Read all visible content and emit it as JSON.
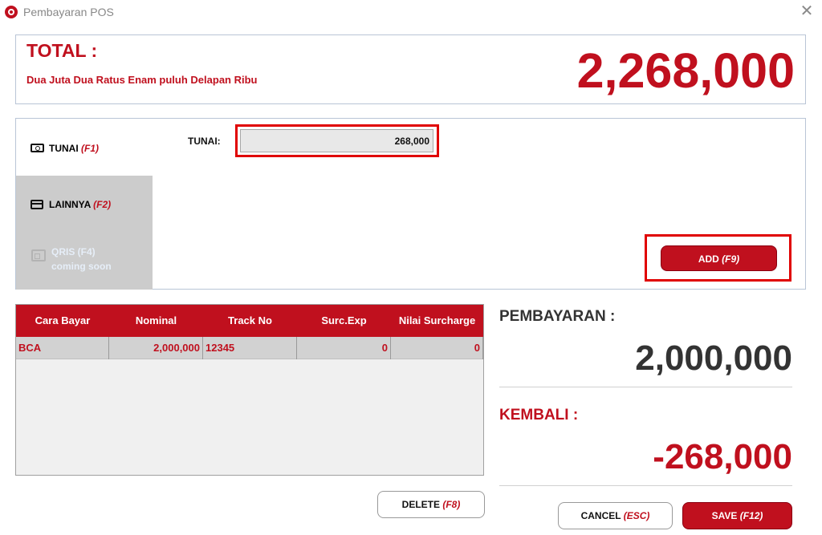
{
  "window": {
    "title": "Pembayaran POS",
    "close_glyph": "✕",
    "icon": "app-logo-icon"
  },
  "total": {
    "label": "TOTAL :",
    "words": "Dua Juta Dua Ratus Enam puluh Delapan Ribu",
    "amount": "2,268,000"
  },
  "tabs": [
    {
      "label": "TUNAI",
      "key": "(F1)",
      "icon": "cash-icon",
      "state": "active"
    },
    {
      "label": "LAINNYA",
      "key": "(F2)",
      "icon": "card-icon",
      "state": "inactive"
    },
    {
      "line1": "QRIS (F4)",
      "line2": "coming soon",
      "icon": "wallet-icon",
      "state": "disabled"
    }
  ],
  "tunai": {
    "label": "TUNAI:",
    "value": "268,000"
  },
  "add_button": {
    "label": "ADD",
    "key": "(F9)"
  },
  "grid": {
    "columns": [
      "Cara Bayar",
      "Nominal",
      "Track No",
      "Surc.Exp",
      "Nilai Surcharge"
    ],
    "rows": [
      [
        "BCA",
        "2,000,000",
        "12345",
        "0",
        "0"
      ]
    ]
  },
  "summary": {
    "pembayaran_label": "PEMBAYARAN :",
    "pembayaran_amount": "2,000,000",
    "kembali_label": "KEMBALI :",
    "kembali_amount": "-268,000"
  },
  "buttons": {
    "delete_label": "DELETE",
    "delete_key": "(F8)",
    "cancel_label": "CANCEL",
    "cancel_key": "(ESC)",
    "save_label": "SAVE",
    "save_key": "(F12)"
  },
  "colors": {
    "accent": "#c0101e",
    "highlight": "#e00000",
    "inactive_tab": "#cccccc"
  }
}
